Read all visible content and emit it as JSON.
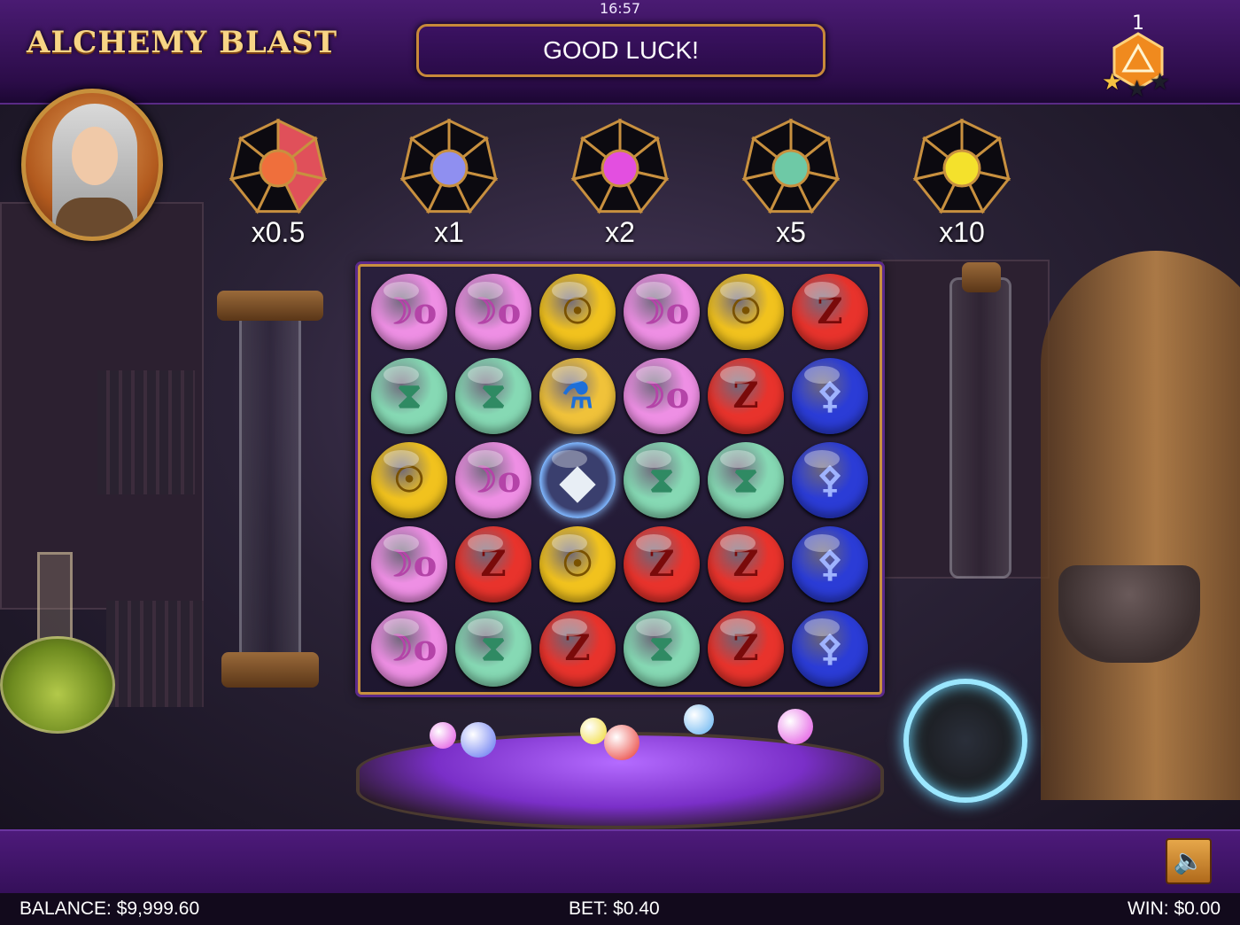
{
  "clock": "16:57",
  "logo": "ALCHEMY BLAST",
  "message": "GOOD LUCK!",
  "level": {
    "number": "1",
    "stars_earned": 1,
    "stars_total": 3
  },
  "multipliers": [
    {
      "label": "x0.5",
      "orb_color": "#ef6f3c",
      "segments_filled": 3,
      "segments_total": 7
    },
    {
      "label": "x1",
      "orb_color": "#8f8ff0",
      "segments_filled": 0,
      "segments_total": 7
    },
    {
      "label": "x2",
      "orb_color": "#e34fe0",
      "segments_filled": 0,
      "segments_total": 7
    },
    {
      "label": "x5",
      "orb_color": "#6ec9a6",
      "segments_filled": 0,
      "segments_total": 7
    },
    {
      "label": "x10",
      "orb_color": "#f4e12c",
      "segments_filled": 0,
      "segments_total": 7
    }
  ],
  "symbols": {
    "moon": {
      "color": "#ee8fe4",
      "glyph": "☽o",
      "glyph_color": "#b444a8",
      "icon": "moon-rune-icon"
    },
    "sun": {
      "color": "#f1c21e",
      "glyph": "☉",
      "glyph_color": "#7a5200",
      "icon": "sun-rune-icon"
    },
    "zigzag": {
      "color": "#e8332c",
      "glyph": "Z",
      "glyph_color": "#7a0a0a",
      "icon": "zigzag-rune-icon"
    },
    "hourglass": {
      "color": "#86d9b4",
      "glyph": "⧗",
      "glyph_color": "#2f8a63",
      "icon": "hourglass-rune-icon"
    },
    "trident": {
      "color": "#2b3cd6",
      "glyph": "⚴",
      "glyph_color": "#9fb3ff",
      "icon": "trident-rune-icon"
    },
    "potion": {
      "color": "#f0c23a",
      "glyph": "⚗",
      "glyph_color": "#1e6fd8",
      "icon": "potion-bonus-icon"
    },
    "crystal": {
      "color": "#3a3f6e",
      "glyph": "◆",
      "glyph_color": "#e8eef5",
      "icon": "crystal-bonus-icon"
    }
  },
  "grid": [
    [
      "moon",
      "moon",
      "sun",
      "moon",
      "sun",
      "zigzag"
    ],
    [
      "hourglass",
      "hourglass",
      "potion",
      "moon",
      "zigzag",
      "trident"
    ],
    [
      "sun",
      "moon",
      "crystal",
      "hourglass",
      "hourglass",
      "trident"
    ],
    [
      "moon",
      "zigzag",
      "sun",
      "zigzag",
      "zigzag",
      "trident"
    ],
    [
      "moon",
      "hourglass",
      "zigzag",
      "hourglass",
      "zigzag",
      "trident"
    ]
  ],
  "status_bar": {
    "balance": "BALANCE: $9,999.60",
    "bet": "BET: $0.40",
    "win": "WIN: $0.00"
  },
  "icons": {
    "sound": "speaker-icon",
    "level": "triangle-level-icon",
    "star": "star-icon"
  },
  "colors": {
    "frame_gold": "#c8903f",
    "bar_purple": "#4d1a7a",
    "star_gold": "#f5c242",
    "star_empty": "#1d1d2a"
  }
}
